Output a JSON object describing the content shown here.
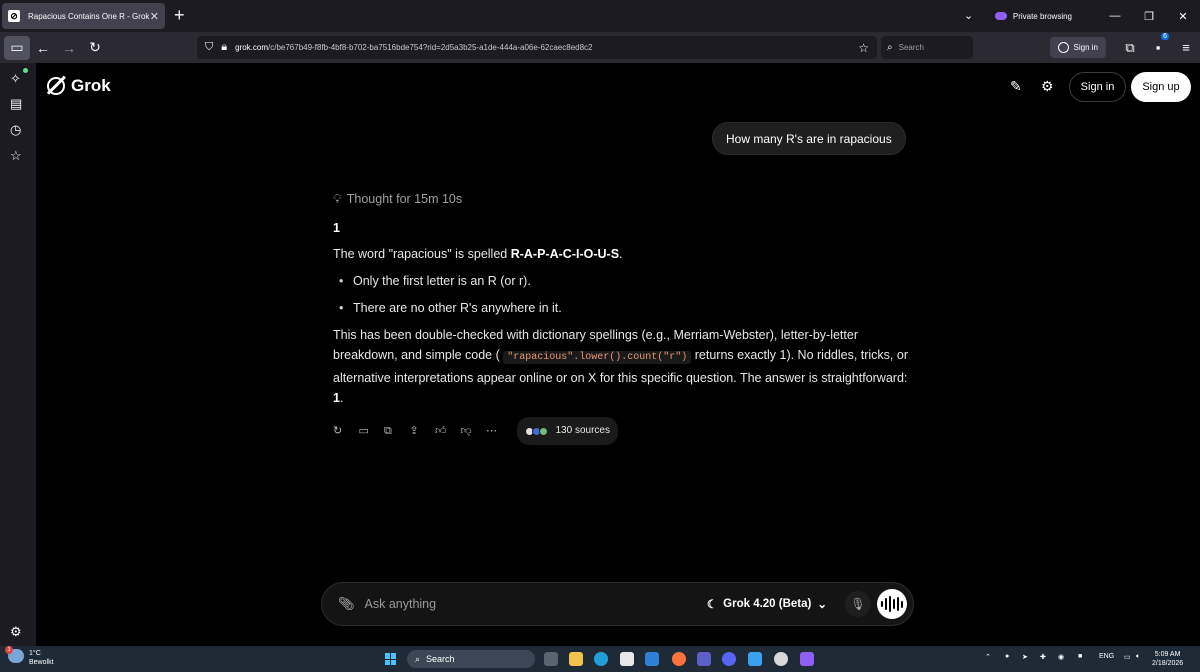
{
  "browser": {
    "tab_title": "Rapacious Contains One R - Grok",
    "tab_favicon": "grok-favicon",
    "private_label": "Private browsing",
    "url_host": "grok.com",
    "url_path": "/c/be767b49-f8fb-4bf8-b702-ba7516bde754?rid=2d5a3b25-a1de-444a-a06e-62caec8ed8c2",
    "search_placeholder": "Search",
    "signin_label": "Sign in",
    "extensions_badge": "6"
  },
  "app": {
    "logo_text": "Grok",
    "signin_label": "Sign in",
    "signup_label": "Sign up"
  },
  "conversation": {
    "user_message": "How many R's are in rapacious",
    "thought_label": "Thought for 15m 10s",
    "answer": "1",
    "p1_prefix": "The word \"rapacious\" is spelled ",
    "p1_bold": "R-A-P-A-C-I-O-U-S",
    "p1_suffix": ".",
    "bullets": [
      "Only the first letter is an R (or r).",
      "There are no other R's anywhere in it."
    ],
    "p2_a": "This has been double-checked with dictionary spellings (e.g., Merriam-Webster), letter-by-letter breakdown, and simple code ( ",
    "p2_code": "\"rapacious\".lower().count(\"r\")",
    "p2_b": " returns exactly 1). No riddles, tricks, or alternative interpretations appear online or on X for this specific question. The answer is straightforward: ",
    "p2_bold": "1",
    "p2_end": ".",
    "sources_label": "130 sources"
  },
  "composer": {
    "placeholder": "Ask anything",
    "model_label": "Grok 4.20 (Beta)"
  },
  "taskbar": {
    "weather_temp": "1°C",
    "weather_desc": "Bewolkt",
    "weather_badge": "1",
    "search_label": "Search",
    "lang": "ENG",
    "time": "5:09 AM",
    "date": "2/18/2026"
  },
  "colors": {
    "background": "#000000",
    "accent_code": "#e89770",
    "browser_chrome": "#2b2a33",
    "private_purple": "#8f5ef7"
  }
}
